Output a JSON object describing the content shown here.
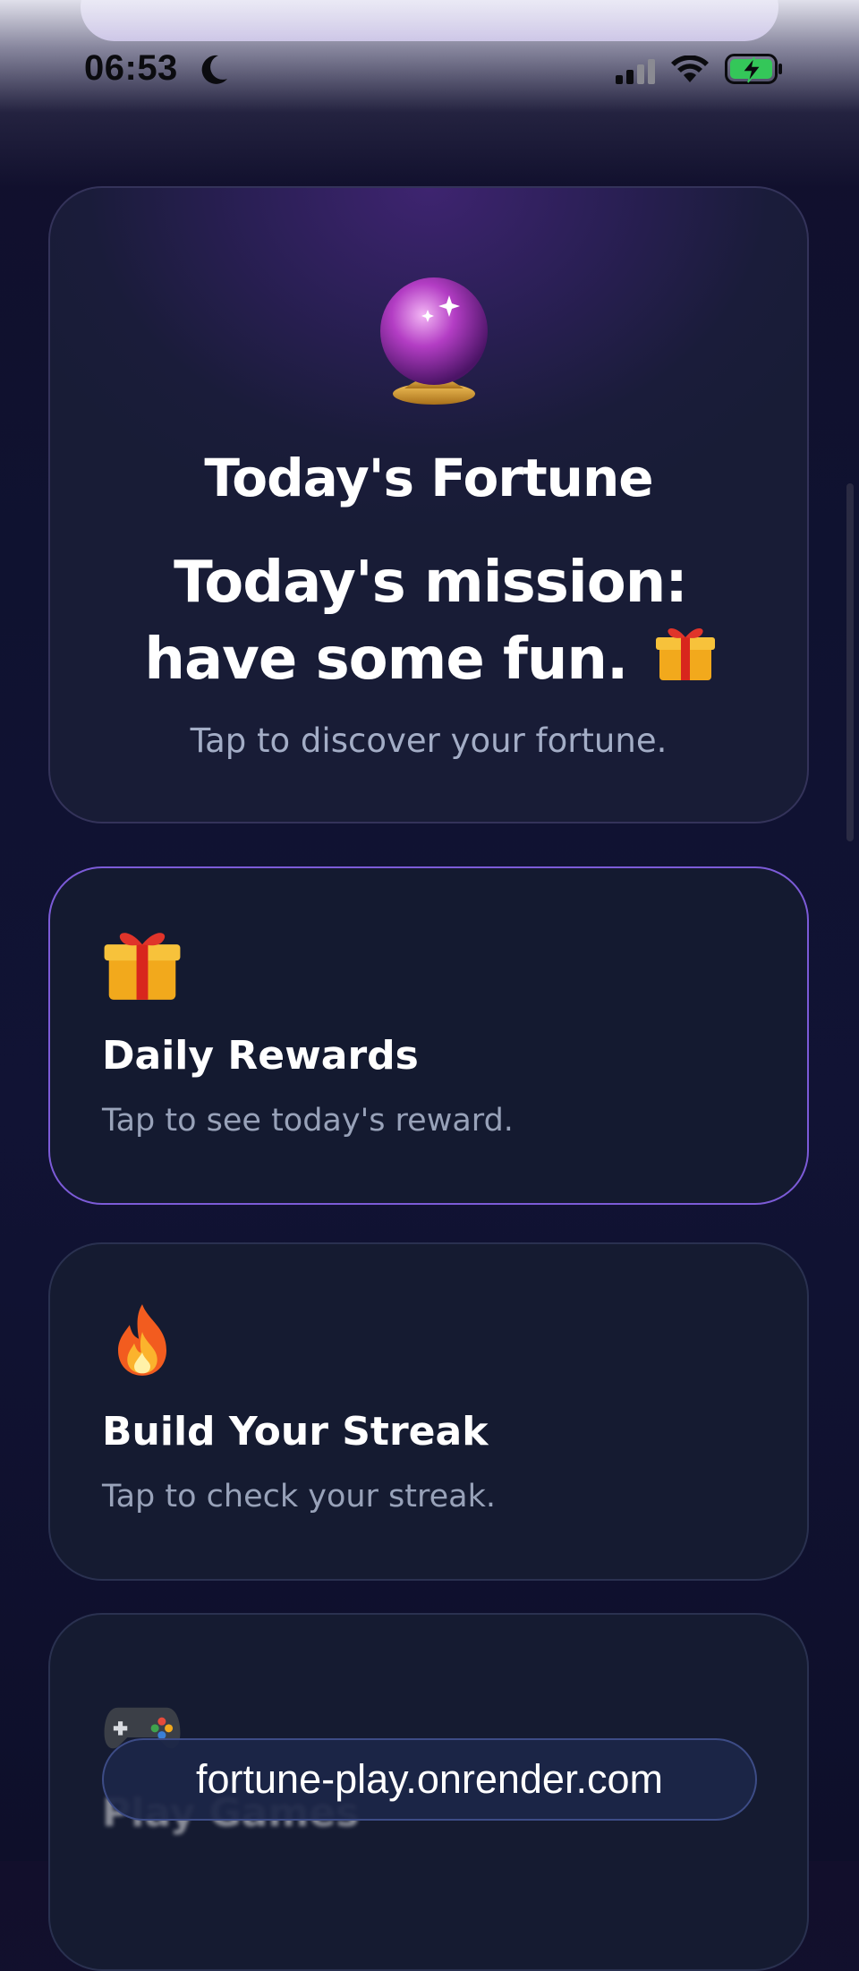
{
  "status_bar": {
    "time": "06:53",
    "icons": [
      "moon-icon",
      "cellular-signal-icon",
      "wifi-icon",
      "battery-charging-icon"
    ],
    "battery_color": "#34c759"
  },
  "hero_card": {
    "icon": "crystal-ball-icon",
    "title": "Today's Fortune",
    "fortune_text": "Today's mission: have some fun.",
    "fortune_icon": "gift-icon",
    "subtitle": "Tap to discover your fortune."
  },
  "features": [
    {
      "icon": "gift-icon",
      "title": "Daily Rewards",
      "subtitle": "Tap to see today's reward.",
      "highlighted": true,
      "accent": "#7c5bd8"
    },
    {
      "icon": "fire-icon",
      "title": "Build Your Streak",
      "subtitle": "Tap to check your streak."
    },
    {
      "icon": "game-controller-icon",
      "title": "Play Games"
    }
  ],
  "browser": {
    "url": "fortune-play.onrender.com"
  },
  "colors": {
    "background": "#111334",
    "card": "#151b31",
    "accent": "#7c5bd8",
    "muted_text": "#a3adc6"
  }
}
